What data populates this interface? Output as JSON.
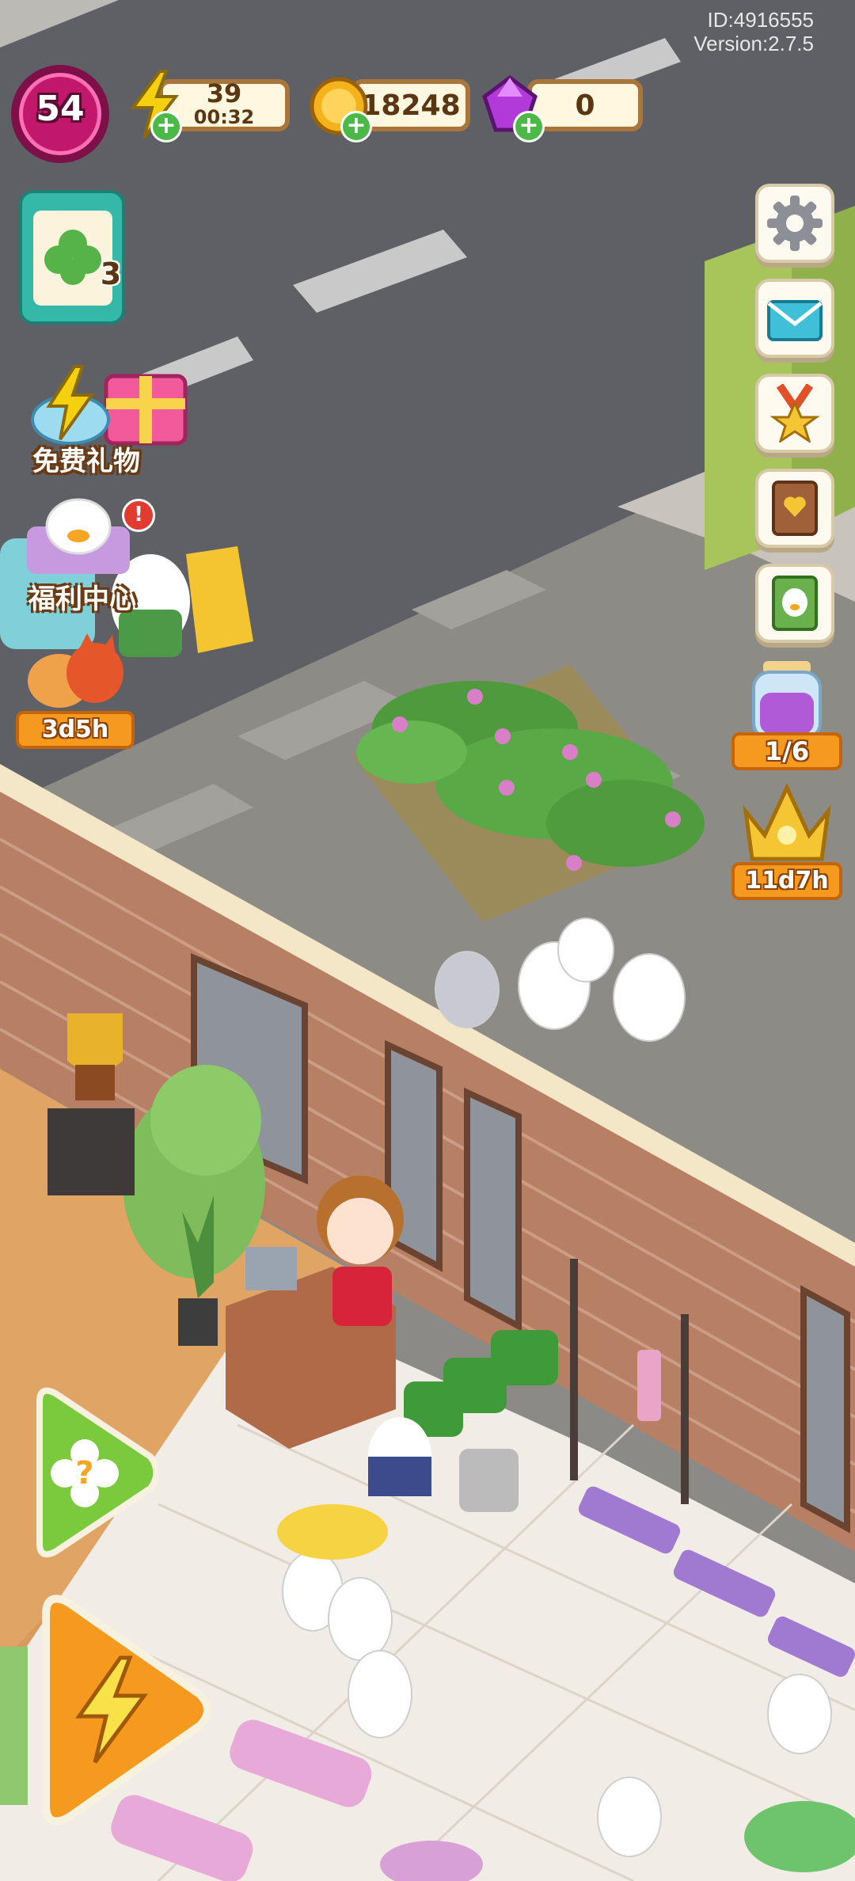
{
  "meta": {
    "id_text": "ID:4916555",
    "version_text": "Version:2.7.5"
  },
  "hud": {
    "level": "54",
    "energy": {
      "value": "39",
      "timer": "00:32"
    },
    "coins": {
      "value": "18248"
    },
    "gems": {
      "value": "0"
    }
  },
  "left_panel": {
    "task_board": {
      "count": "3"
    },
    "free_gift": {
      "label": "免费礼物"
    },
    "welfare_center": {
      "label": "福利中心"
    },
    "event": {
      "timer": "3d5h"
    }
  },
  "right_panel": {
    "jar_event": {
      "progress": "1/6"
    },
    "crown_event": {
      "timer": "11d7h"
    }
  },
  "icons": {
    "settings": "gear-icon",
    "mail": "mail-icon",
    "medal": "medal-icon",
    "book": "book-icon",
    "guide": "guide-book-icon",
    "help": "question-icon",
    "boost": "lightning-icon"
  },
  "colors": {
    "level_ring": "#c2186b",
    "coin": "#f6b21a",
    "gem": "#b23ad8",
    "energy": "#f4d00f",
    "plus": "#4cb848"
  }
}
